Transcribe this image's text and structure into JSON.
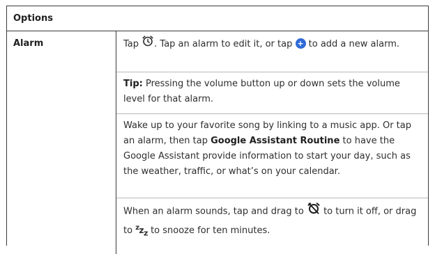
{
  "table": {
    "header": "Options",
    "row_label": "Alarm",
    "p1": {
      "before_clock": "Tap",
      "after_clock": ". Tap an alarm to edit it, or tap",
      "after_plus": "to add a new alarm."
    },
    "p2": {
      "tip_label": "Tip:",
      "text": "Pressing the volume button up or down sets the volume level for that alarm."
    },
    "p3": {
      "part1": "Wake up to your favorite song by linking to a music app. Or tap an alarm, then tap",
      "bold": "Google Assistant Routine",
      "part2": "to have the Google Assistant provide information to start your day, such as the weather, traffic, or what’s on your calendar."
    },
    "p4": {
      "part1": "When an alarm sounds, tap and drag to",
      "part2": "to turn it off, or drag to",
      "part3": "to snooze for ten minutes."
    }
  },
  "icons": {
    "clock": "alarm-clock-icon",
    "plus": "add-alarm-plus-icon",
    "alarm_off": "alarm-off-icon",
    "snooze": "snooze-zz-icon"
  },
  "colors": {
    "plus_badge": "#2f6bd6",
    "text": "#2e2e2e",
    "border": "#3a3a3a"
  }
}
